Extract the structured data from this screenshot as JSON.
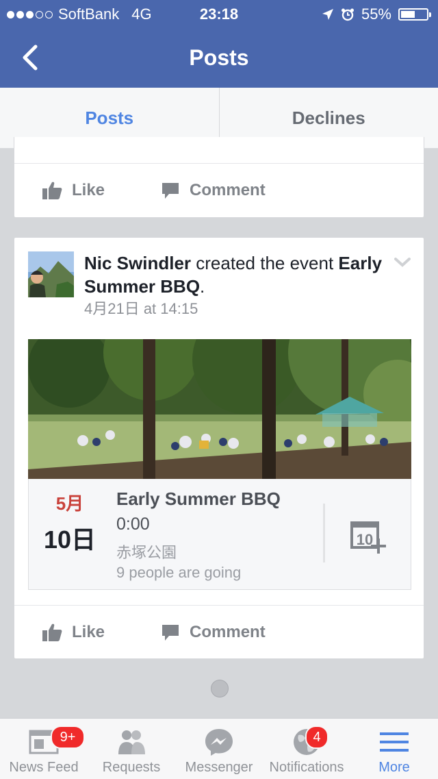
{
  "status_bar": {
    "carrier": "SoftBank",
    "network": "4G",
    "time": "23:18",
    "battery": "55%",
    "battery_level": 0.55,
    "signal_bars": 3,
    "signal_total": 5
  },
  "navbar": {
    "title": "Posts",
    "back_icon": "chevron-left-icon"
  },
  "segment": {
    "tabs": [
      {
        "label": "Posts",
        "active": true
      },
      {
        "label": "Declines",
        "active": false
      }
    ]
  },
  "actions": {
    "like": "Like",
    "comment": "Comment"
  },
  "post": {
    "author": "Nic Swindler",
    "verb": " created the event ",
    "event_link": "Early Summer BBQ",
    "period": ".",
    "timestamp": "4月21日 at 14:15"
  },
  "event": {
    "month": "5月",
    "day": "10日",
    "title": "Early Summer BBQ",
    "time": "0:00",
    "place": "赤塚公園",
    "going": "9 people are going",
    "calendar_icon": "add-to-calendar-icon"
  },
  "tabbar": {
    "items": [
      {
        "label": "News Feed",
        "badge": "9+",
        "icon": "news-feed-icon"
      },
      {
        "label": "Requests",
        "badge": "",
        "icon": "friend-requests-icon"
      },
      {
        "label": "Messenger",
        "badge": "",
        "icon": "messenger-icon"
      },
      {
        "label": "Notifications",
        "badge": "4",
        "icon": "globe-icon"
      },
      {
        "label": "More",
        "badge": "",
        "icon": "menu-icon",
        "active": true
      }
    ]
  },
  "colors": {
    "brand": "#4a67ad",
    "accent": "#4f85e2",
    "badge": "#f02a2a",
    "month": "#c9423b"
  }
}
